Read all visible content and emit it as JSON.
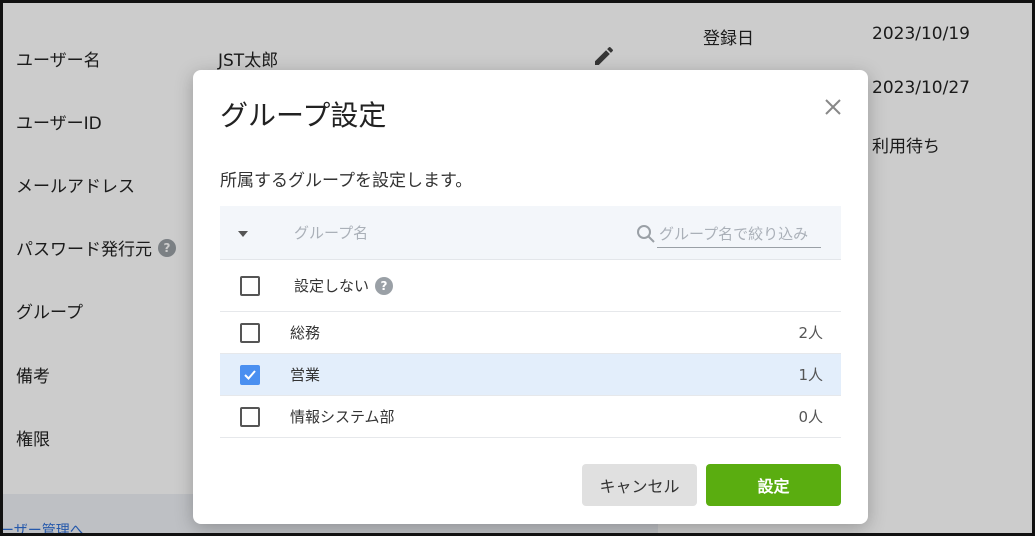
{
  "background": {
    "rows": [
      {
        "label": "ユーザー名",
        "value": "JST太郎"
      },
      {
        "label": "ユーザーID",
        "value": ""
      },
      {
        "label": "メールアドレス",
        "value": ""
      },
      {
        "label": "パスワード発行元",
        "value": ""
      },
      {
        "label": "グループ",
        "value": ""
      },
      {
        "label": "備考",
        "value": ""
      },
      {
        "label": "権限",
        "value": ""
      }
    ],
    "right": [
      {
        "label": "登録日",
        "value": "2023/10/19"
      },
      {
        "label": "",
        "value": "2023/10/27"
      },
      {
        "label": "",
        "value": "利用待ち"
      }
    ],
    "help_mark": "?",
    "footer_link": "ーザー管理へ"
  },
  "modal": {
    "title": "グループ設定",
    "description": "所属するグループを設定します。",
    "table": {
      "header_name": "グループ名",
      "search_placeholder": "グループ名で絞り込み",
      "none_row": {
        "label": "設定しない",
        "help": "?"
      },
      "rows": [
        {
          "name": "総務",
          "count": "2人",
          "checked": false
        },
        {
          "name": "営業",
          "count": "1人",
          "checked": true
        },
        {
          "name": "情報システム部",
          "count": "0人",
          "checked": false
        }
      ]
    },
    "cancel_label": "キャンセル",
    "confirm_label": "設定"
  },
  "colors": {
    "accent_green": "#5aad10",
    "check_blue": "#4a8ff0",
    "selected_row": "#e3eefb"
  }
}
